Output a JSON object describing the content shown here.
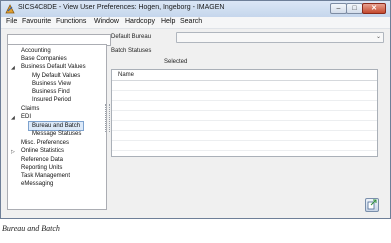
{
  "window": {
    "title": "SICS4C8DE - View User Preferences: Hogen, Ingeborg - IMAGEN",
    "minimize_glyph": "–",
    "maximize_glyph": "□",
    "close_glyph": "✕"
  },
  "menubar": {
    "items": [
      "File",
      "Favourite",
      "Functions",
      "Window",
      "Hardcopy",
      "Help",
      "Search"
    ]
  },
  "tree": {
    "search_placeholder": "",
    "nodes": [
      {
        "label": "Accounting",
        "level": 0
      },
      {
        "label": "Base Companies",
        "level": 0
      },
      {
        "label": "Business Default Values",
        "level": 0,
        "expanded": true
      },
      {
        "label": "My Default Values",
        "level": 1
      },
      {
        "label": "Business View",
        "level": 1
      },
      {
        "label": "Business Find",
        "level": 1
      },
      {
        "label": "Insured Period",
        "level": 1
      },
      {
        "label": "Claims",
        "level": 0
      },
      {
        "label": "EDI",
        "level": 0,
        "expanded": true
      },
      {
        "label": "Bureau and Batch",
        "level": 1,
        "selected": true
      },
      {
        "label": "Message Statuses",
        "level": 1
      },
      {
        "label": "Misc. Preferences",
        "level": 0
      },
      {
        "label": "Online Statistics",
        "level": 0,
        "collapsed": true
      },
      {
        "label": "Reference Data",
        "level": 0
      },
      {
        "label": "Reporting Units",
        "level": 0
      },
      {
        "label": "Task Management",
        "level": 0
      },
      {
        "label": "eMessaging",
        "level": 0
      }
    ]
  },
  "form": {
    "default_bureau_label": "Default Bureau",
    "default_bureau_value": "",
    "batch_statuses_label": "Batch Statuses",
    "selected_label": "Selected",
    "grid_name_header": "Name"
  },
  "icons": {
    "app": "app-logo-icon",
    "expanded": "triangle-down-icon",
    "collapsed": "triangle-right-icon",
    "export": "export-icon"
  },
  "caption": "Bureau and Batch",
  "colors": {
    "titlebar": "#c5d6ec",
    "window_bg": "#f0f0f0",
    "selection": "#dce9f8",
    "close": "#c44a2f"
  }
}
